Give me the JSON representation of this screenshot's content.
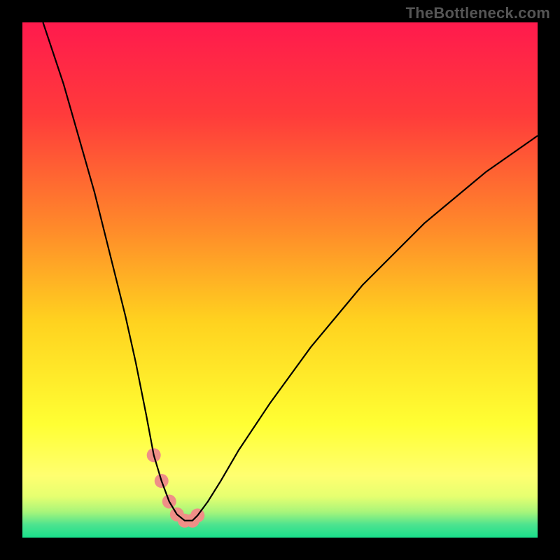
{
  "watermark": "TheBottleneck.com",
  "chart_data": {
    "type": "line",
    "title": "",
    "xlabel": "",
    "ylabel": "",
    "xlim": [
      0,
      100
    ],
    "ylim": [
      0,
      100
    ],
    "background_gradient": {
      "stops": [
        {
          "offset": 0.0,
          "color": "#ff1a4d"
        },
        {
          "offset": 0.18,
          "color": "#ff3b3b"
        },
        {
          "offset": 0.4,
          "color": "#ff8a2a"
        },
        {
          "offset": 0.58,
          "color": "#ffd21f"
        },
        {
          "offset": 0.78,
          "color": "#ffff33"
        },
        {
          "offset": 0.88,
          "color": "#ffff70"
        },
        {
          "offset": 0.92,
          "color": "#e6ff70"
        },
        {
          "offset": 0.95,
          "color": "#a8f57a"
        },
        {
          "offset": 0.975,
          "color": "#4de38f"
        },
        {
          "offset": 1.0,
          "color": "#19e08b"
        }
      ]
    },
    "series": [
      {
        "name": "bottleneck-curve",
        "color": "#000000",
        "x": [
          4,
          6,
          8,
          10,
          12,
          14,
          16,
          18,
          20,
          22,
          24,
          25.5,
          27,
          28.5,
          30,
          31.5,
          33,
          34,
          36,
          38.5,
          42,
          48,
          56,
          66,
          78,
          90,
          100
        ],
        "y": [
          100,
          94,
          88,
          81,
          74,
          67,
          59,
          51,
          43,
          34,
          24,
          16,
          11,
          7,
          4.5,
          3.3,
          3.3,
          4.3,
          7,
          11,
          17,
          26,
          37,
          49,
          61,
          71,
          78
        ]
      }
    ],
    "markers": {
      "name": "highlight-segment",
      "color": "#ef8f87",
      "radius_px": 10,
      "x": [
        25.5,
        27,
        28.5,
        30,
        31.5,
        33,
        34
      ],
      "y": [
        16,
        11,
        7,
        4.5,
        3.3,
        3.3,
        4.3
      ]
    }
  }
}
